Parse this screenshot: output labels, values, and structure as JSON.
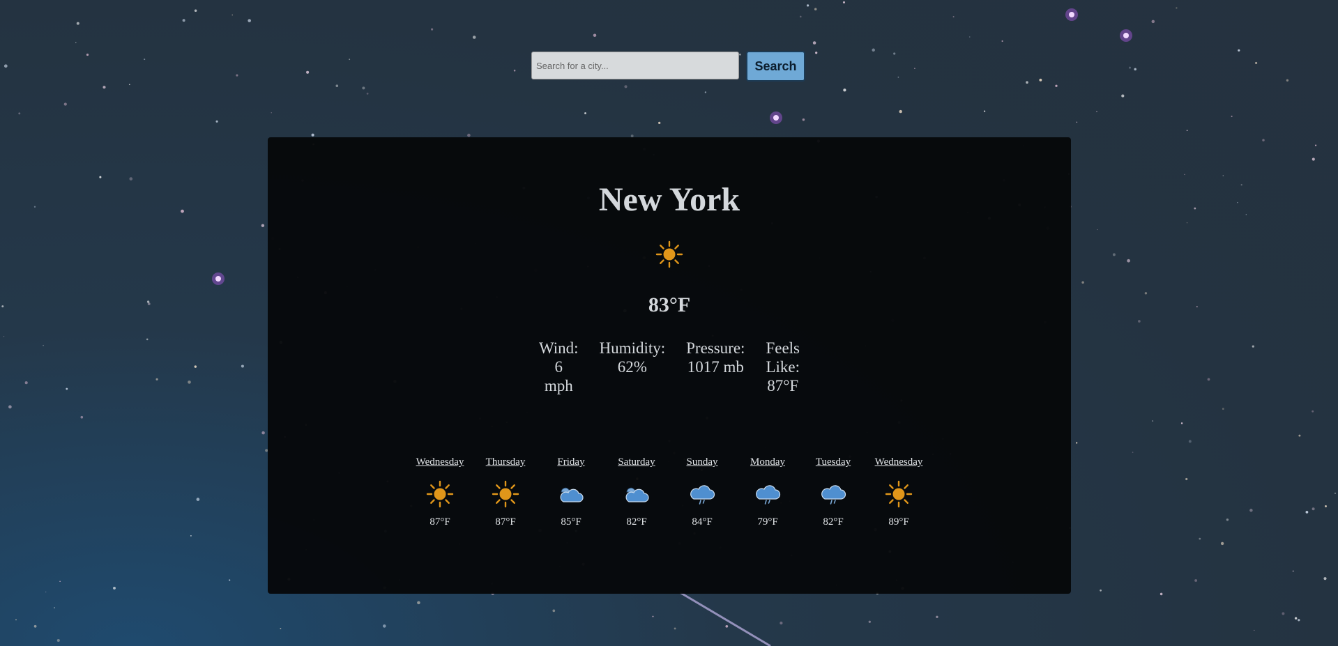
{
  "search": {
    "placeholder": "Search for a city...",
    "value": "",
    "button_label": "Search"
  },
  "current": {
    "city": "New York",
    "icon": "sun-icon",
    "temperature": "83°F",
    "details": [
      {
        "label": "Wind:",
        "lines": [
          "6",
          "mph"
        ]
      },
      {
        "label": "Humidity:",
        "lines": [
          "62%"
        ]
      },
      {
        "label": "Pressure:",
        "lines": [
          "1017 mb"
        ]
      },
      {
        "label_lines": [
          "Feels",
          "Like:"
        ],
        "lines": [
          "87°F"
        ]
      }
    ]
  },
  "forecast": [
    {
      "day": "Wednesday",
      "icon": "sun-icon",
      "temp": "87°F"
    },
    {
      "day": "Thursday",
      "icon": "sun-icon",
      "temp": "87°F"
    },
    {
      "day": "Friday",
      "icon": "partly-cloudy-icon",
      "temp": "85°F"
    },
    {
      "day": "Saturday",
      "icon": "partly-cloudy-icon",
      "temp": "82°F"
    },
    {
      "day": "Sunday",
      "icon": "rain-cloud-icon",
      "temp": "84°F"
    },
    {
      "day": "Monday",
      "icon": "rain-cloud-icon",
      "temp": "79°F"
    },
    {
      "day": "Tuesday",
      "icon": "rain-cloud-icon",
      "temp": "82°F"
    },
    {
      "day": "Wednesday",
      "icon": "sun-icon",
      "temp": "89°F"
    }
  ],
  "colors": {
    "sun": "#e0961a",
    "cloud": "#4f8fd0",
    "cloud_dark": "#7aa9d8",
    "button": "#6fa9d6",
    "text": "#d4d8dc"
  }
}
